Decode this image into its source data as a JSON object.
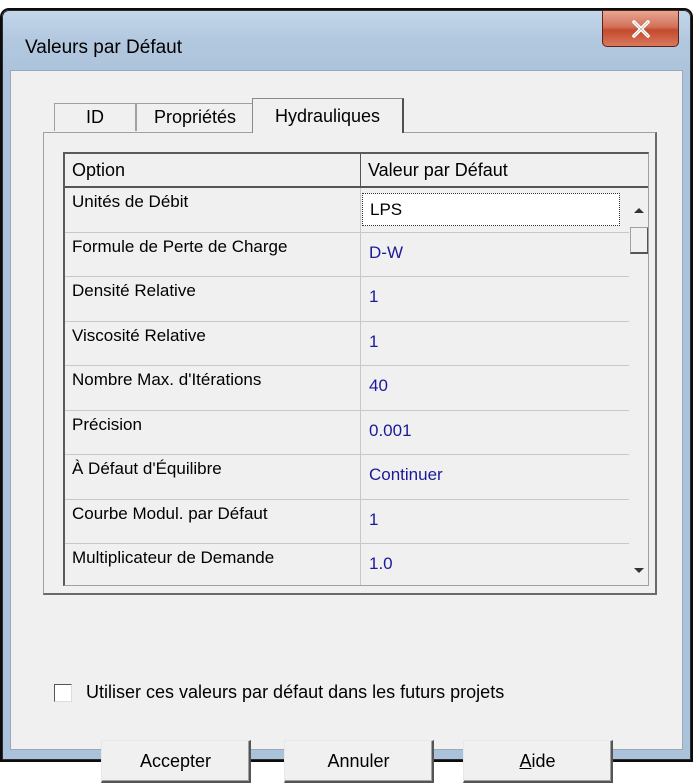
{
  "window": {
    "title": "Valeurs par Défaut"
  },
  "tabs": [
    {
      "label": "ID"
    },
    {
      "label": "Propriétés"
    },
    {
      "label": "Hydrauliques",
      "active": true
    }
  ],
  "grid": {
    "columns": [
      "Option",
      "Valeur par Défaut"
    ],
    "rows": [
      {
        "option": "Unités de Débit",
        "value": "LPS",
        "editing": true
      },
      {
        "option": "Formule de Perte de Charge",
        "value": "D-W"
      },
      {
        "option": "Densité Relative",
        "value": "1"
      },
      {
        "option": "Viscosité Relative",
        "value": "1"
      },
      {
        "option": "Nombre Max. d'Itérations",
        "value": "40"
      },
      {
        "option": "Précision",
        "value": "0.001"
      },
      {
        "option": "À Défaut d'Équilibre",
        "value": "Continuer"
      },
      {
        "option": "Courbe Modul. par Défaut",
        "value": "1"
      },
      {
        "option": "Multiplicateur de Demande",
        "value": "1.0"
      }
    ]
  },
  "checkbox": {
    "label": "Utiliser ces valeurs par défaut dans les futurs projets",
    "checked": false
  },
  "buttons": {
    "accept": "Accepter",
    "cancel": "Annuler",
    "help_mnemonic": "A",
    "help_rest": "ide"
  },
  "colors": {
    "value_text": "#1a1a9a",
    "close_button": "#c44a2e",
    "dialog_bg": "#f0f0f0"
  }
}
